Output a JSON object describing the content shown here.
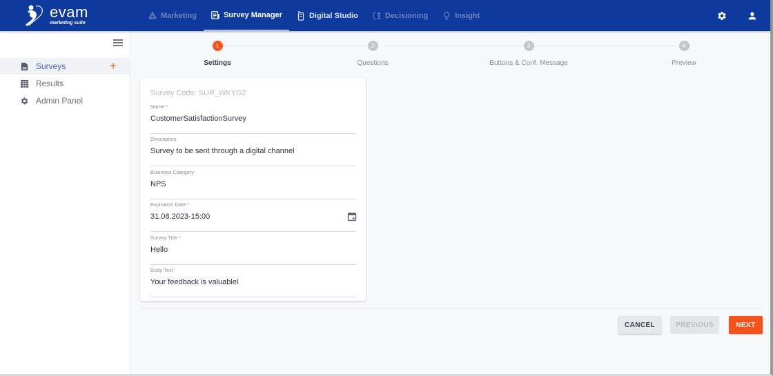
{
  "brand": {
    "name": "evam",
    "tagline": "marketing suite",
    "primary_color": "#0d3a9c",
    "accent_color": "#f4531c"
  },
  "nav": {
    "items": [
      {
        "label": "Marketing",
        "icon": "marketing-icon",
        "state": "inactive"
      },
      {
        "label": "Survey Manager",
        "icon": "survey-manager-icon",
        "state": "active"
      },
      {
        "label": "Digital Studio",
        "icon": "digital-studio-icon",
        "state": "semi"
      },
      {
        "label": "Decisioning",
        "icon": "decisioning-icon",
        "state": "inactive"
      },
      {
        "label": "Insight",
        "icon": "insight-icon",
        "state": "inactive"
      }
    ],
    "right_icons": [
      "gear-icon",
      "user-icon"
    ]
  },
  "sidebar": {
    "menu_icon": "hamburger-icon",
    "items": [
      {
        "label": "Surveys",
        "icon": "document-icon",
        "active": true,
        "action": "+"
      },
      {
        "label": "Results",
        "icon": "table-icon",
        "active": false
      },
      {
        "label": "Admin Panel",
        "icon": "gear-icon",
        "active": false
      }
    ]
  },
  "stepper": {
    "steps": [
      {
        "number": "1",
        "label": "Settings",
        "active": true
      },
      {
        "number": "2",
        "label": "Questions",
        "active": false
      },
      {
        "number": "3",
        "label": "Buttons & Conf. Message",
        "active": false
      },
      {
        "number": "4",
        "label": "Preview",
        "active": false
      }
    ]
  },
  "form": {
    "survey_code": "Survey Code: SUR_WKYG2",
    "fields": [
      {
        "label": "Name *",
        "value": "CustomerSatisfactionSurvey"
      },
      {
        "label": "Description",
        "value": "Survey to be sent through a digital channel"
      },
      {
        "label": "Business Category",
        "value": "NPS"
      },
      {
        "label": "Expiration Date *",
        "value": "31.08.2023-15:00",
        "icon": "calendar-icon"
      },
      {
        "label": "Survey Title *",
        "value": "Hello"
      },
      {
        "label": "Body Text",
        "value": "Your feedback is valuable!"
      }
    ]
  },
  "actions": {
    "cancel": "CANCEL",
    "previous": "PREVIOUS",
    "next": "NEXT"
  }
}
